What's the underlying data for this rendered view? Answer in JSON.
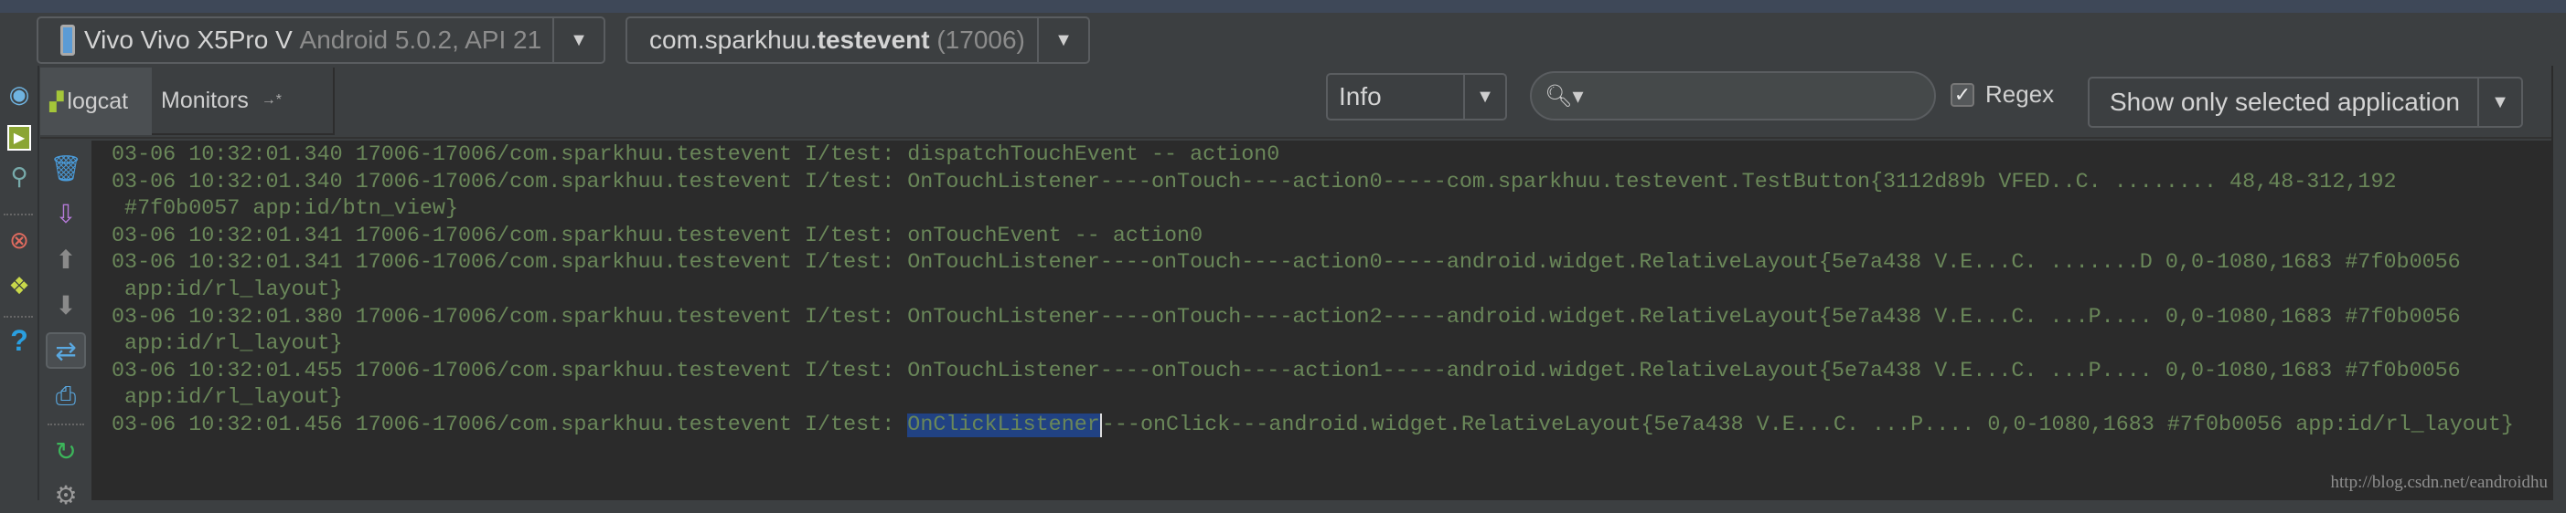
{
  "toolbar": {
    "device": {
      "name": "Vivo Vivo X5Pro V",
      "detail": "Android 5.0.2, API 21"
    },
    "process": {
      "package_prefix": "com.sparkhuu.",
      "package_bold": "testevent",
      "pid": "(17006)"
    }
  },
  "tabs": [
    {
      "label": "logcat",
      "selected": true
    },
    {
      "label": "Monitors",
      "suffix": "→*"
    }
  ],
  "filter": {
    "log_level": "Info",
    "search_value": "",
    "search_placeholder": "",
    "regex_label": "Regex",
    "regex_checked": true,
    "app_filter": "Show only selected application"
  },
  "log_lines": [
    "03-06 10:32:01.340 17006-17006/com.sparkhuu.testevent I/test: dispatchTouchEvent -- action0",
    "03-06 10:32:01.340 17006-17006/com.sparkhuu.testevent I/test: OnTouchListener----onTouch----action0-----com.sparkhuu.testevent.TestButton{3112d89b VFED..C. ........ 48,48-312,192",
    " #7f0b0057 app:id/btn_view}",
    "03-06 10:32:01.341 17006-17006/com.sparkhuu.testevent I/test: onTouchEvent -- action0",
    "03-06 10:32:01.341 17006-17006/com.sparkhuu.testevent I/test: OnTouchListener----onTouch----action0-----android.widget.RelativeLayout{5e7a438 V.E...C. .......D 0,0-1080,1683 #7f0b0056",
    " app:id/rl_layout}",
    "03-06 10:32:01.380 17006-17006/com.sparkhuu.testevent I/test: OnTouchListener----onTouch----action2-----android.widget.RelativeLayout{5e7a438 V.E...C. ...P.... 0,0-1080,1683 #7f0b0056",
    " app:id/rl_layout}",
    "03-06 10:32:01.455 17006-17006/com.sparkhuu.testevent I/test: OnTouchListener----onTouch----action1-----android.widget.RelativeLayout{5e7a438 V.E...C. ...P.... 0,0-1080,1683 #7f0b0056",
    " app:id/rl_layout}"
  ],
  "last_line": {
    "prefix": "03-06 10:32:01.456 17006-17006/com.sparkhuu.testevent I/test: ",
    "selected": "OnClickListener",
    "rest": "---onClick---android.widget.RelativeLayout{5e7a438 V.E...C. ...P.... 0,0-1080,1683 #7f0b0056 app:id/rl_layout}"
  },
  "watermark": "http://blog.csdn.net/eandroidhu",
  "colors": {
    "log_text": "#6a8759",
    "selection": "#214283",
    "background": "#2b2b2b"
  }
}
